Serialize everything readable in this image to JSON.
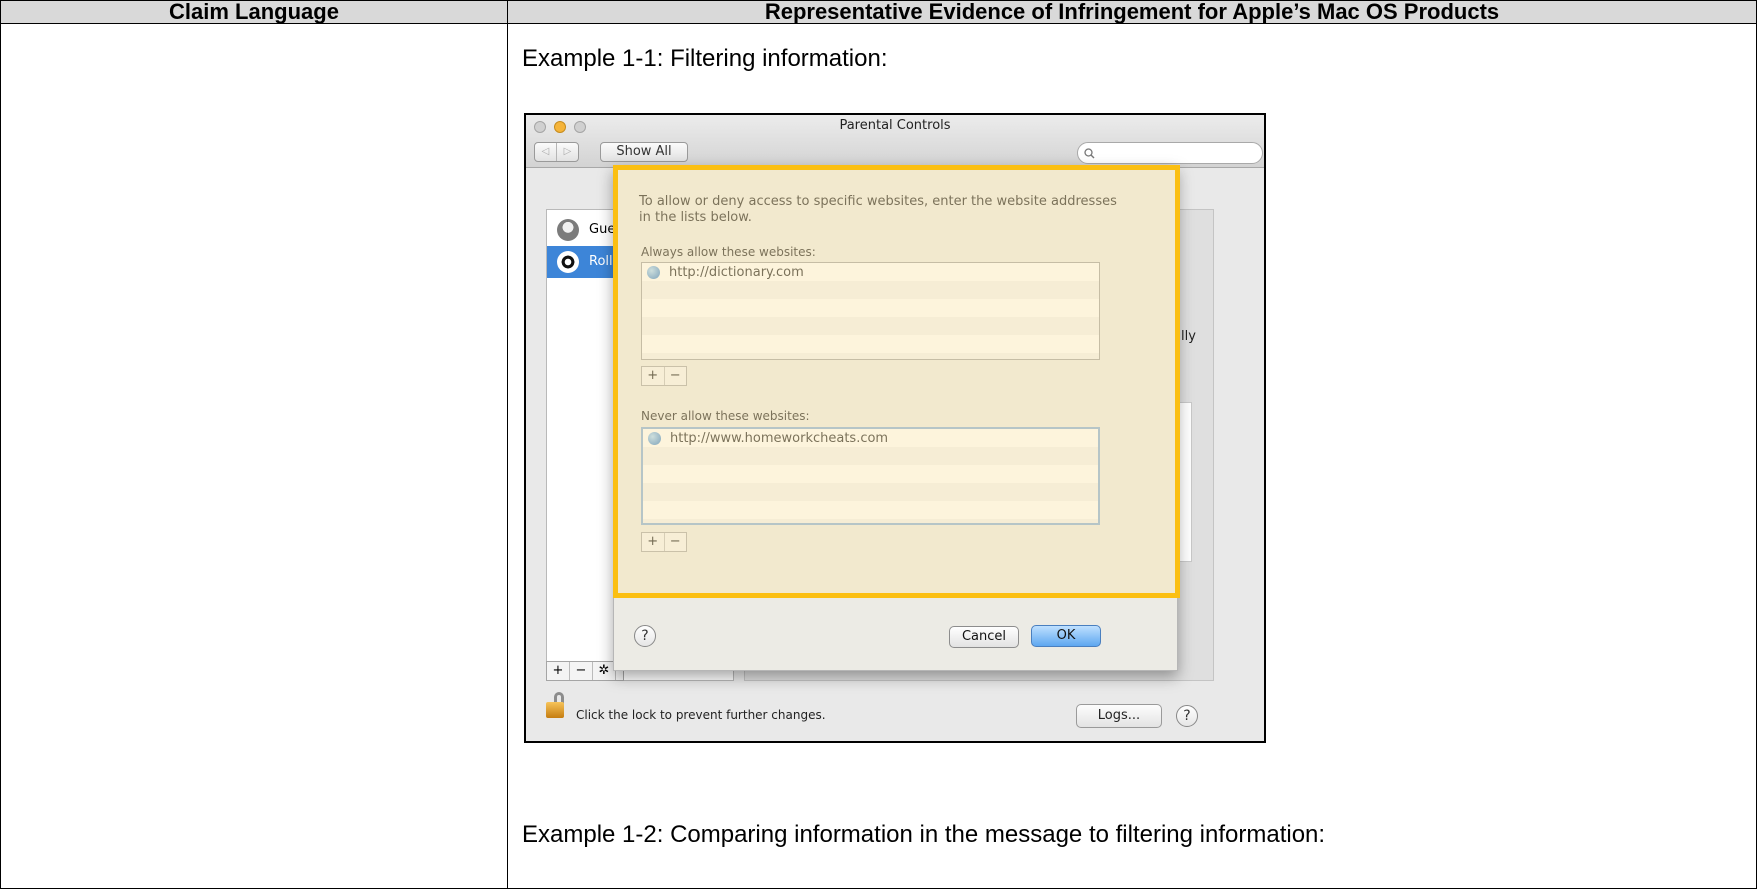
{
  "table": {
    "col1_header": "Claim Language",
    "col2_header": "Representative Evidence of Infringement for Apple’s Mac OS Products"
  },
  "captions": {
    "example1": "Example 1-1:  Filtering information:",
    "example2": "Example 1-2: Comparing information in the message to filtering information:"
  },
  "window": {
    "title": "Parental Controls",
    "show_all": "Show All",
    "search_icon": "magnifier",
    "nav_back": "◁",
    "nav_forward": "▷",
    "users": [
      {
        "name": "Gue",
        "avatar": "silhouette-icon"
      },
      {
        "name": "Roll",
        "avatar": "soccer-ball-icon"
      }
    ],
    "list_buttons": [
      "+",
      "−",
      "✲"
    ],
    "background_text_partial": "ally",
    "lock_text": "Click the lock to prevent further changes.",
    "logs_button": "Logs...",
    "help": "?"
  },
  "sheet": {
    "intro": "To allow or deny access to specific websites, enter the website addresses in the lists below.",
    "allow_label": "Always allow these websites:",
    "allow_sites": [
      "http://dictionary.com"
    ],
    "never_label": "Never allow these websites:",
    "never_sites": [
      "http://www.homeworkcheats.com"
    ],
    "plus": "+",
    "minus": "−",
    "help": "?",
    "cancel": "Cancel",
    "ok": "OK"
  },
  "colors": {
    "header_bg": "#d9d9d9",
    "highlight": "#fbbf12",
    "selection": "#3d85d8"
  }
}
